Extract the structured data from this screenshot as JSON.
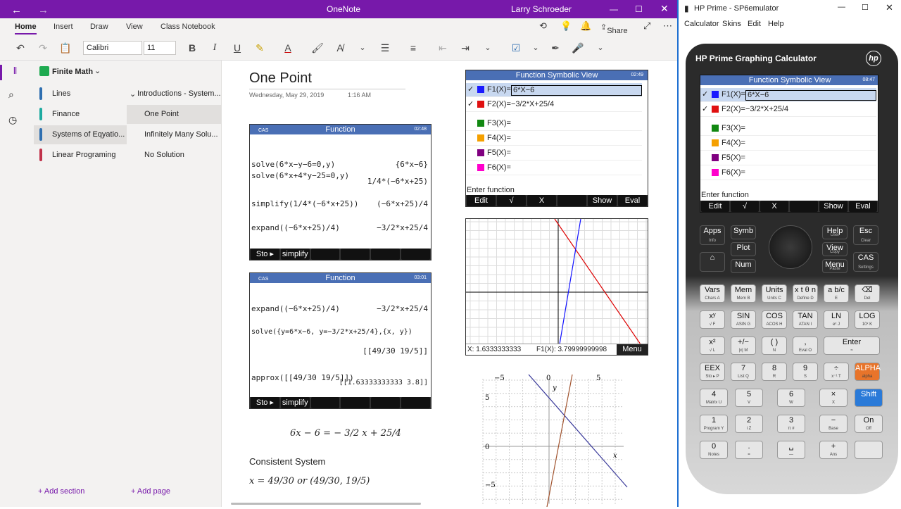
{
  "onenote": {
    "title": "OneNote",
    "user": "Larry Schroeder",
    "tabs": [
      "Home",
      "Insert",
      "Draw",
      "View",
      "Class Notebook"
    ],
    "share": "Share",
    "font": "Calibri",
    "font_size": "11",
    "notebook": "Finite Math",
    "sections": [
      {
        "label": "Lines",
        "color": "#2e6fb0"
      },
      {
        "label": "Finance",
        "color": "#1eaaa0"
      },
      {
        "label": "Systems of Eqyatio...",
        "color": "#2e6fb0"
      },
      {
        "label": "Linear Programing",
        "color": "#c0324a"
      }
    ],
    "pages": [
      "Introductions - System...",
      "One Point",
      "Infinitely Many Solu...",
      "No Solution"
    ],
    "add_section": "Add section",
    "add_page": "Add page",
    "page_title": "One Point",
    "page_date": "Wednesday, May 29, 2019",
    "page_time": "1:16 AM",
    "consistent": "Consistent System"
  },
  "screen1": {
    "header": "Function",
    "clock": "02:48",
    "cas": "CAS",
    "lines": [
      [
        "solve(6*x−y−6=0,y)",
        "{6*x−6}"
      ],
      [
        "solve(6*x+4*y−25=0,y)",
        "1/4*(−6*x+25)"
      ],
      [
        "simplify(1/4*(−6*x+25))",
        "(−6*x+25)/4"
      ],
      [
        "expand((−6*x+25)/4)",
        "−3/2*x+25/4"
      ]
    ],
    "soft": [
      "Sto ▸",
      "simplify",
      "",
      "",
      "",
      ""
    ]
  },
  "screen2": {
    "header": "Function",
    "clock": "03:01",
    "cas": "CAS",
    "lines": [
      [
        "expand((−6*x+25)/4)",
        "−3/2*x+25/4"
      ],
      [
        "solve({y=6*x−6, y=−3/2*x+25/4},{x, y})",
        "[[49/30  19/5]]"
      ],
      [
        "approx([[49/30  19/5]])",
        "[[1.63333333333  3.8]]"
      ]
    ],
    "soft": [
      "Sto ▸",
      "simplify",
      "",
      "",
      "",
      ""
    ]
  },
  "symb": {
    "header": "Function Symbolic View",
    "clock": "02:49",
    "funcs": [
      {
        "name": "F1(X)=",
        "expr": "6*X−6",
        "checked": "✓",
        "color": "#1a1aff"
      },
      {
        "name": "F2(X)=",
        "expr": "−3/2*X+25/4",
        "checked": "✓",
        "color": "#e01010"
      },
      {
        "name": "F3(X)=",
        "expr": "",
        "checked": "",
        "color": "#118811"
      },
      {
        "name": "F4(X)=",
        "expr": "",
        "checked": "",
        "color": "#f5a000"
      },
      {
        "name": "F5(X)=",
        "expr": "",
        "checked": "",
        "color": "#800080"
      },
      {
        "name": "F6(X)=",
        "expr": "",
        "checked": "",
        "color": "#ff00cc"
      }
    ],
    "prompt": "Enter function",
    "soft": [
      "Edit",
      "√",
      "X",
      "",
      "Show",
      "Eval"
    ]
  },
  "plot": {
    "readout_x": "X: 1.6333333333",
    "readout_f": "F1(X): 3.79999999998",
    "menu": "Menu"
  },
  "graph": {
    "ticks_x": [
      "−5",
      "0",
      "5"
    ],
    "ticks_y": [
      "5",
      "0",
      "−5"
    ],
    "xlabel": "x",
    "ylabel": "y"
  },
  "math": {
    "eq": "6x − 6 = − 3/2 x + 25/4",
    "sol": "x = 49/30  or  (49/30, 19/5)"
  },
  "hp": {
    "title": "HP Prime - SP6emulator",
    "menu": [
      "Calculator",
      "Skins",
      "Edit",
      "Help"
    ],
    "brand": "HP Prime Graphing Calculator",
    "logo": "hp",
    "clock": "08:47",
    "header": "Function Symbolic View",
    "prompt": "Enter function",
    "soft": [
      "Edit",
      "√",
      "X",
      "",
      "Show",
      "Eval"
    ],
    "keys": [
      [
        "Apps",
        "Info"
      ],
      [
        "Esc",
        "Clear"
      ],
      [
        "Help",
        "User"
      ],
      [
        "View",
        "Copy"
      ],
      [
        "Menu",
        "Paste"
      ],
      [
        "CAS",
        "Settings"
      ],
      [
        "Vars",
        "Chars A"
      ],
      [
        "Mem",
        "Mem B"
      ],
      [
        "Units",
        "Units C"
      ],
      [
        "x t θ n",
        "Define D"
      ],
      [
        "a b/c",
        "E"
      ],
      [
        "⌫",
        "Del"
      ],
      [
        "xʸ",
        "√ F"
      ],
      [
        "SIN",
        "ASIN G"
      ],
      [
        "COS",
        "ACOS H"
      ],
      [
        "TAN",
        "ATAN I"
      ],
      [
        "LN",
        "eˣ J"
      ],
      [
        "LOG",
        "10ˣ K"
      ],
      [
        "x²",
        "√ L"
      ],
      [
        "+/−",
        "|x| M"
      ],
      [
        "( )",
        "N"
      ],
      [
        ", ",
        "Eval O"
      ],
      [
        "Enter",
        "≈"
      ],
      [
        "EEX",
        "Sto ▸ P"
      ],
      [
        "7",
        "List Q"
      ],
      [
        "8",
        "R"
      ],
      [
        "9",
        "S"
      ],
      [
        "÷",
        "x⁻¹ T"
      ],
      [
        "ALPHA",
        "alpha"
      ],
      [
        "4",
        "Matrix U"
      ],
      [
        "5",
        "V"
      ],
      [
        "6",
        "W"
      ],
      [
        "×",
        "X"
      ],
      [
        "Shift",
        ""
      ],
      [
        "1",
        "Program Y"
      ],
      [
        "2",
        "i Z"
      ],
      [
        "3",
        "π #"
      ],
      [
        "−",
        "Base"
      ],
      [
        "On",
        "Off"
      ],
      [
        "0",
        "Notes"
      ],
      [
        ".",
        "="
      ],
      [
        "␣",
        "—"
      ],
      [
        "+",
        "Ans"
      ]
    ]
  }
}
